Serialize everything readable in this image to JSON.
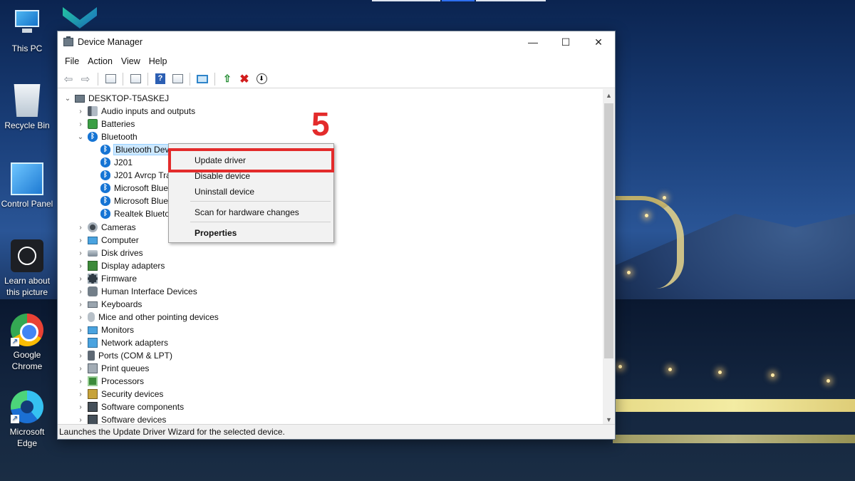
{
  "desktop": {
    "icons": [
      {
        "label": "This PC"
      },
      {
        "label": "Recycle Bin"
      },
      {
        "label": "Control Panel"
      },
      {
        "label": "Learn about this picture"
      },
      {
        "label": "Google Chrome"
      },
      {
        "label": "Microsoft Edge"
      }
    ]
  },
  "window": {
    "title": "Device Manager",
    "controls": {
      "minimize": "—",
      "maximize": "☐",
      "close": "✕"
    },
    "menu": [
      "File",
      "Action",
      "View",
      "Help"
    ],
    "status": "Launches the Update Driver Wizard for the selected device."
  },
  "tree": {
    "root": "DESKTOP-T5ASKEJ",
    "categories_top": [
      {
        "label": "Audio inputs and outputs",
        "icon": "speaker-icon"
      },
      {
        "label": "Batteries",
        "icon": "battery-icon"
      },
      {
        "label": "Bluetooth",
        "icon": "bluetooth-icon"
      }
    ],
    "bluetooth_children": [
      "Bluetooth Device (RFCOMM Protocol TDI)",
      "J201",
      "J201 Avrcp Transport",
      "Microsoft Bluetooth Enumerator",
      "Microsoft Bluetooth LE Enumerator",
      "Realtek Bluetooth Adapter"
    ],
    "categories_rest": [
      {
        "label": "Cameras",
        "icon": "camera-icon"
      },
      {
        "label": "Computer",
        "icon": "monitor-icon"
      },
      {
        "label": "Disk drives",
        "icon": "disk-icon"
      },
      {
        "label": "Display adapters",
        "icon": "display-adapter-icon"
      },
      {
        "label": "Firmware",
        "icon": "chip-icon"
      },
      {
        "label": "Human Interface Devices",
        "icon": "hid-icon"
      },
      {
        "label": "Keyboards",
        "icon": "keyboard-icon"
      },
      {
        "label": "Mice and other pointing devices",
        "icon": "mouse-icon"
      },
      {
        "label": "Monitors",
        "icon": "monitor-icon"
      },
      {
        "label": "Network adapters",
        "icon": "network-icon"
      },
      {
        "label": "Ports (COM & LPT)",
        "icon": "port-icon"
      },
      {
        "label": "Print queues",
        "icon": "printer-icon"
      },
      {
        "label": "Processors",
        "icon": "cpu-icon"
      },
      {
        "label": "Security devices",
        "icon": "security-icon"
      },
      {
        "label": "Software components",
        "icon": "software-icon"
      },
      {
        "label": "Software devices",
        "icon": "software-icon"
      }
    ]
  },
  "context_menu": {
    "items": [
      "Update driver",
      "Disable device",
      "Uninstall device",
      "Scan for hardware changes",
      "Properties"
    ]
  },
  "annotation": {
    "step": "5",
    "color": "#e32b2b"
  }
}
